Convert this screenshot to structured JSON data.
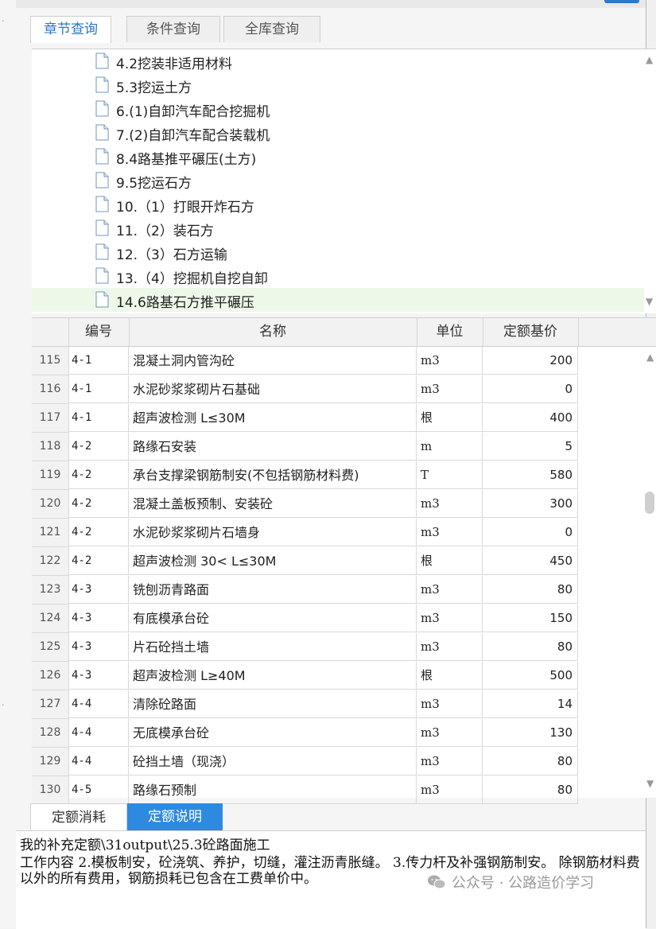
{
  "tabs": [
    {
      "label": "章节查询",
      "active": true
    },
    {
      "label": "条件查询",
      "active": false
    },
    {
      "label": "全库查询",
      "active": false
    }
  ],
  "tree": {
    "items": [
      "4.2挖装非适用材料",
      "5.3挖运土方",
      "6.(1)自卸汽车配合挖掘机",
      "7.(2)自卸汽车配合装载机",
      "8.4路基推平碾压(土方)",
      "9.5挖运石方",
      "10.（1）打眼开炸石方",
      "11.（2）装石方",
      "12.（3）石方运输",
      "13.（4）挖掘机自挖自卸",
      "14.6路基石方推平碾压"
    ],
    "selected_index": 10
  },
  "grid": {
    "headers": {
      "code": "编号",
      "name": "名称",
      "unit": "单位",
      "price": "定额基价"
    },
    "rows": [
      {
        "rn": "115",
        "code": "4-1",
        "name": "混凝土洞内管沟砼",
        "unit": "m3",
        "price": "200"
      },
      {
        "rn": "116",
        "code": "4-1",
        "name": "水泥砂浆浆砌片石基础",
        "unit": "m3",
        "price": "0"
      },
      {
        "rn": "117",
        "code": "4-1",
        "name": "超声波检测  L≤30M",
        "unit": "根",
        "price": "400"
      },
      {
        "rn": "118",
        "code": "4-2",
        "name": "路缘石安装",
        "unit": "m",
        "price": "5"
      },
      {
        "rn": "119",
        "code": "4-2",
        "name": "承台支撑梁钢筋制安(不包括钢筋材料费)",
        "unit": "T",
        "price": "580"
      },
      {
        "rn": "120",
        "code": "4-2",
        "name": "混凝土盖板预制、安装砼",
        "unit": "m3",
        "price": "300"
      },
      {
        "rn": "121",
        "code": "4-2",
        "name": "水泥砂浆浆砌片石墙身",
        "unit": "m3",
        "price": "0"
      },
      {
        "rn": "122",
        "code": "4-2",
        "name": "超声波检测 30< L≤30M",
        "unit": "根",
        "price": "450"
      },
      {
        "rn": "123",
        "code": "4-3",
        "name": "铣刨沥青路面",
        "unit": "m3",
        "price": "80"
      },
      {
        "rn": "124",
        "code": "4-3",
        "name": "有底模承台砼",
        "unit": "m3",
        "price": "150"
      },
      {
        "rn": "125",
        "code": "4-3",
        "name": "片石砼挡土墙",
        "unit": "m3",
        "price": "80"
      },
      {
        "rn": "126",
        "code": "4-3",
        "name": "超声波检测  L≥40M",
        "unit": "根",
        "price": "500"
      },
      {
        "rn": "127",
        "code": "4-4",
        "name": "清除砼路面",
        "unit": "m3",
        "price": "14"
      },
      {
        "rn": "128",
        "code": "4-4",
        "name": "无底模承台砼",
        "unit": "m3",
        "price": "130"
      },
      {
        "rn": "129",
        "code": "4-4",
        "name": "砼挡土墙（现浇）",
        "unit": "m3",
        "price": "80"
      },
      {
        "rn": "130",
        "code": "4-5",
        "name": "路缘石预制",
        "unit": "m3",
        "price": "80"
      }
    ]
  },
  "bottom_tabs": [
    {
      "label": "定额消耗",
      "active": false
    },
    {
      "label": "定额说明",
      "active": true
    }
  ],
  "description": {
    "line1": "我的补充定额\\31output\\25.3砼路面施工",
    "line2": "工作内容 2.模板制安，砼浇筑、养护，切缝，灌注沥青胀缝。 3.传力杆及补强钢筋制安。 除钢筋材料费以外的所有费用，钢筋损耗已包含在工费单价中。"
  },
  "watermark": "公众号 · 公路造价学习",
  "colors": {
    "accent": "#2e8ae0",
    "selected_row": "#eef8e8",
    "tab_active_text": "#2a77c9"
  }
}
